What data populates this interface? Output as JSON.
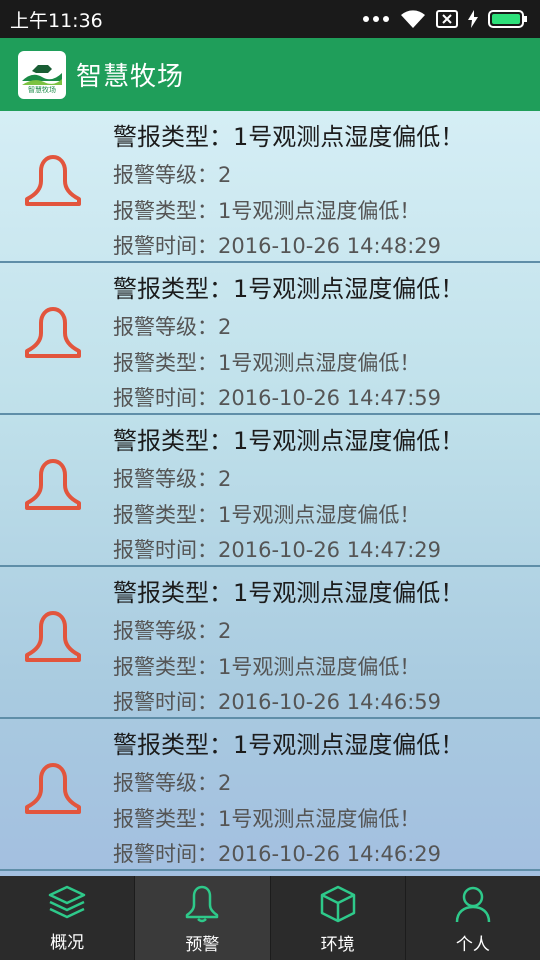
{
  "status_bar": {
    "time": "上午11:36"
  },
  "app": {
    "title": "智慧牧场",
    "logo_text": "智慧牧场"
  },
  "alerts": [
    {
      "title": "警报类型：1号观测点湿度偏低！",
      "level": "报警等级：2",
      "type": "报警类型：1号观测点湿度偏低！",
      "time": "报警时间：2016-10-26 14:48:29"
    },
    {
      "title": "警报类型：1号观测点湿度偏低！",
      "level": "报警等级：2",
      "type": "报警类型：1号观测点湿度偏低！",
      "time": "报警时间：2016-10-26 14:47:59"
    },
    {
      "title": "警报类型：1号观测点湿度偏低！",
      "level": "报警等级：2",
      "type": "报警类型：1号观测点湿度偏低！",
      "time": "报警时间：2016-10-26 14:47:29"
    },
    {
      "title": "警报类型：1号观测点湿度偏低！",
      "level": "报警等级：2",
      "type": "报警类型：1号观测点湿度偏低！",
      "time": "报警时间：2016-10-26 14:46:59"
    },
    {
      "title": "警报类型：1号观测点湿度偏低！",
      "level": "报警等级：2",
      "type": "报警类型：1号观测点湿度偏低！",
      "time": "报警时间：2016-10-26 14:46:29"
    }
  ],
  "nav": [
    {
      "label": "概况",
      "icon": "layers-icon"
    },
    {
      "label": "预警",
      "icon": "bell-icon"
    },
    {
      "label": "环境",
      "icon": "cube-icon"
    },
    {
      "label": "个人",
      "icon": "person-icon"
    }
  ],
  "colors": {
    "appbar": "#1f9e5a",
    "bell": "#e2553d",
    "nav_icon": "#2ec98a"
  }
}
